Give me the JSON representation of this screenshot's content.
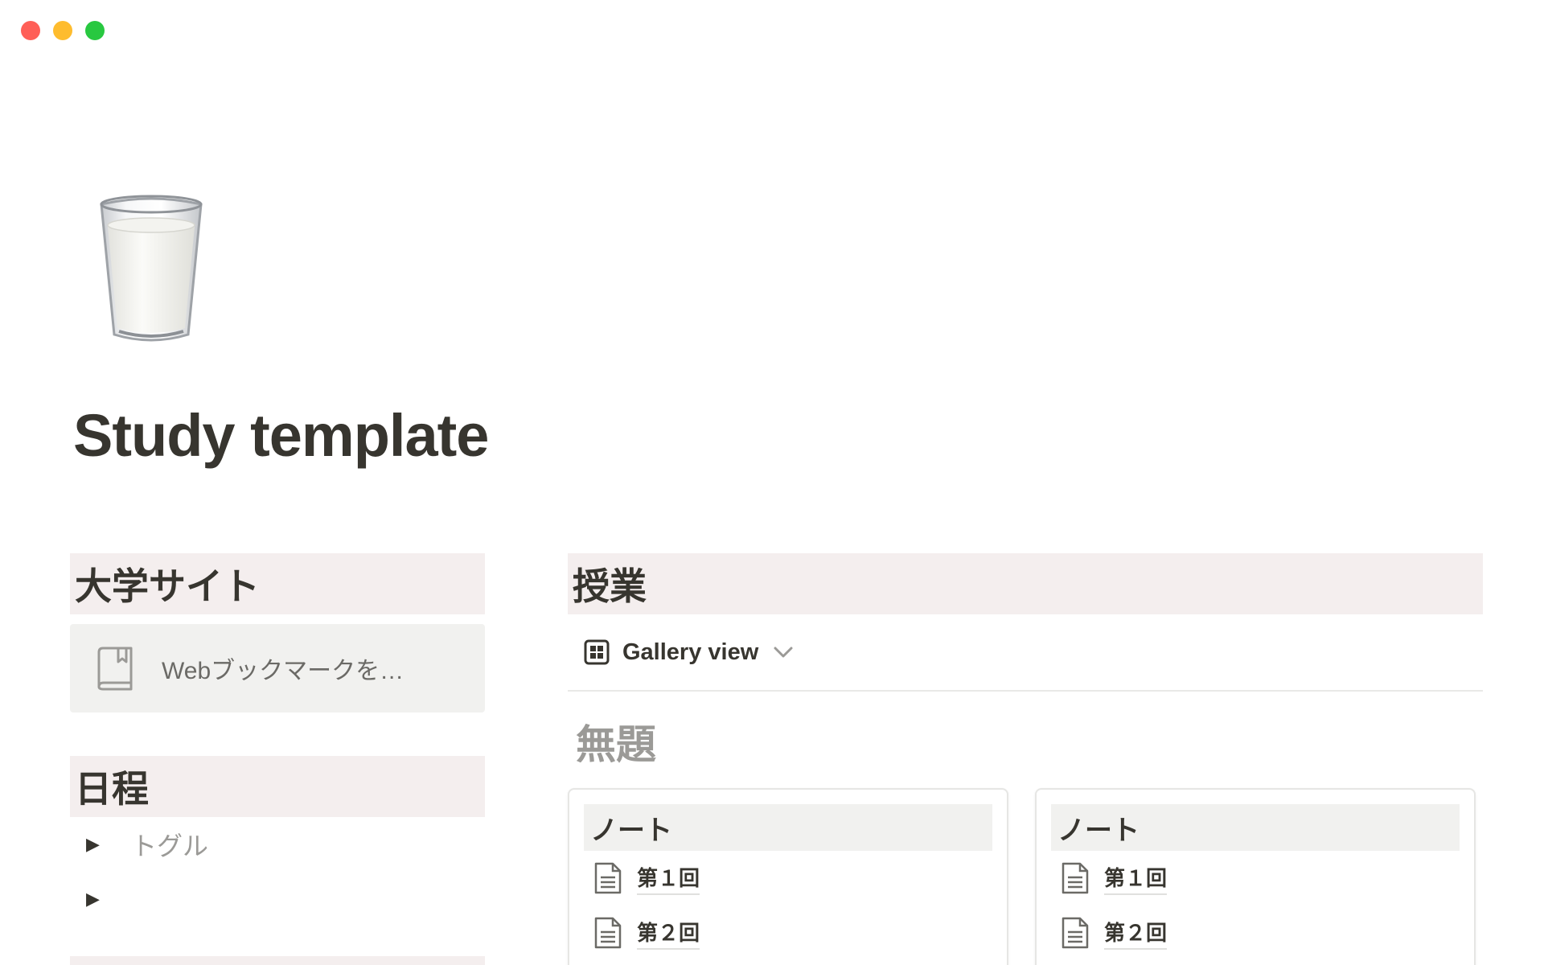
{
  "window": {
    "traffic_lights": [
      {
        "name": "close",
        "color": "#ff5f57"
      },
      {
        "name": "minimize",
        "color": "#febc2e"
      },
      {
        "name": "zoom",
        "color": "#28c840"
      }
    ]
  },
  "page": {
    "icon": "milk-glass-icon",
    "title": "Study template"
  },
  "left": {
    "university_site": {
      "heading": "大学サイト",
      "bookmark": {
        "icon": "bookmark-book-icon",
        "label": "Webブックマークを…"
      }
    },
    "schedule": {
      "heading": "日程",
      "toggles": [
        {
          "label": "トグル"
        },
        {
          "label": ""
        }
      ]
    }
  },
  "right": {
    "heading": "授業",
    "view": {
      "icon": "gallery-grid-icon",
      "label": "Gallery view"
    },
    "group_title": "無題",
    "cards": [
      {
        "header": "ノート",
        "items": [
          {
            "label": "第１回"
          },
          {
            "label": "第２回"
          }
        ]
      },
      {
        "header": "ノート",
        "items": [
          {
            "label": "第１回"
          },
          {
            "label": "第２回"
          }
        ]
      }
    ]
  },
  "colors": {
    "text": "#37352f",
    "muted": "#9b9a97",
    "section_bg": "#f4eeee",
    "bookmark_bg": "#f1f1ef"
  }
}
